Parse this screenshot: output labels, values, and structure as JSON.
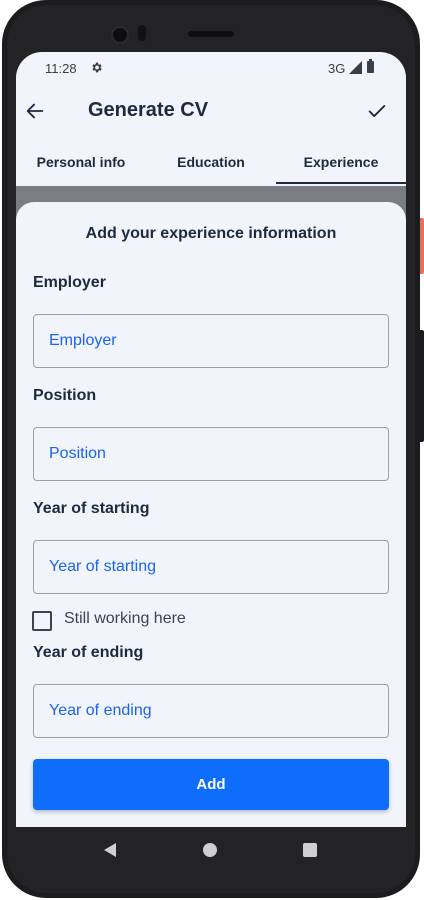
{
  "status_bar": {
    "time": "11:28",
    "network": "3G"
  },
  "app_bar": {
    "title": "Generate CV"
  },
  "tabs": [
    {
      "label": "Personal info"
    },
    {
      "label": "Education"
    },
    {
      "label": "Experience",
      "selected": true
    }
  ],
  "form": {
    "heading": "Add your experience information",
    "employer": {
      "label": "Employer",
      "placeholder": "Employer",
      "value": ""
    },
    "position": {
      "label": "Position",
      "placeholder": "Position",
      "value": ""
    },
    "year_start": {
      "label": "Year of starting",
      "placeholder": "Year of starting",
      "value": ""
    },
    "still_working": {
      "label": "Still working here",
      "checked": false
    },
    "year_end": {
      "label": "Year of ending",
      "placeholder": "Year of ending",
      "value": ""
    },
    "add_label": "Add"
  },
  "colors": {
    "accent": "#0e6dfb",
    "text_primary": "#1d2a3f",
    "placeholder": "#1a64f2",
    "screen_bg": "#f1f4fb"
  },
  "icons": [
    "gear-icon",
    "signal-icon",
    "battery-icon",
    "back-arrow-icon",
    "check-icon",
    "nav-back-icon",
    "nav-home-icon",
    "nav-recents-icon"
  ]
}
